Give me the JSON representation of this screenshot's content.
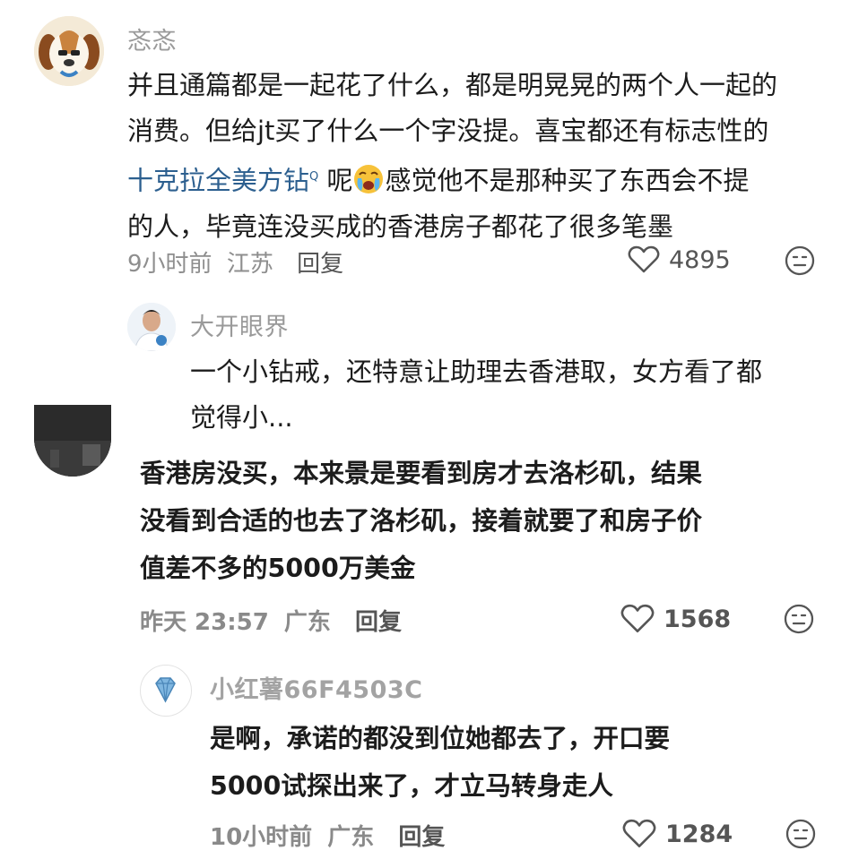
{
  "comments": [
    {
      "user": "忞忞",
      "lines": [
        "并且通篇都是一起花了什么，都是明晃晃的两个人一起的",
        "消费。但给jt买了什么一个字没提。喜宝都还有标志性的"
      ],
      "line3_link": "十克拉全美方钻",
      "line3_rest_a": " 呢",
      "line3_rest_b": "感觉他不是那种买了东西会不提",
      "line4": "的人，毕竟连没买成的香港房子都花了很多笔墨",
      "time": "9小时前",
      "location": "江苏",
      "reply": "回复",
      "likes": "4895"
    },
    {
      "user": "大开眼界",
      "lines": [
        "一个小钻戒，还特意让助理去香港取，女方看了都",
        "觉得小..."
      ]
    },
    {
      "lines": [
        "香港房没买，本来景是要看到房才去洛杉矶，结果",
        "没看到合适的也去了洛杉矶，接着就要了和房子价",
        "值差不多的5000万美金"
      ],
      "time": "昨天 23:57",
      "location": "广东",
      "reply": "回复",
      "likes": "1568"
    },
    {
      "user": "小红薯66F4503C",
      "lines": [
        "是啊，承诺的都没到位她都去了，开口要",
        "5000试探出来了，才立马转身走人"
      ],
      "time": "10小时前",
      "location": "广东",
      "reply": "回复",
      "likes": "1284"
    }
  ],
  "search_mark": "Q",
  "icons": {
    "like": "heart-outline-icon",
    "dislike": "neutral-face-icon",
    "emoji": "crying-face-emoji",
    "diamond": "diamond-icon"
  },
  "colors": {
    "link": "#2c5f8f",
    "username": "#9a9a9a",
    "meta": "#8e8e8e"
  }
}
